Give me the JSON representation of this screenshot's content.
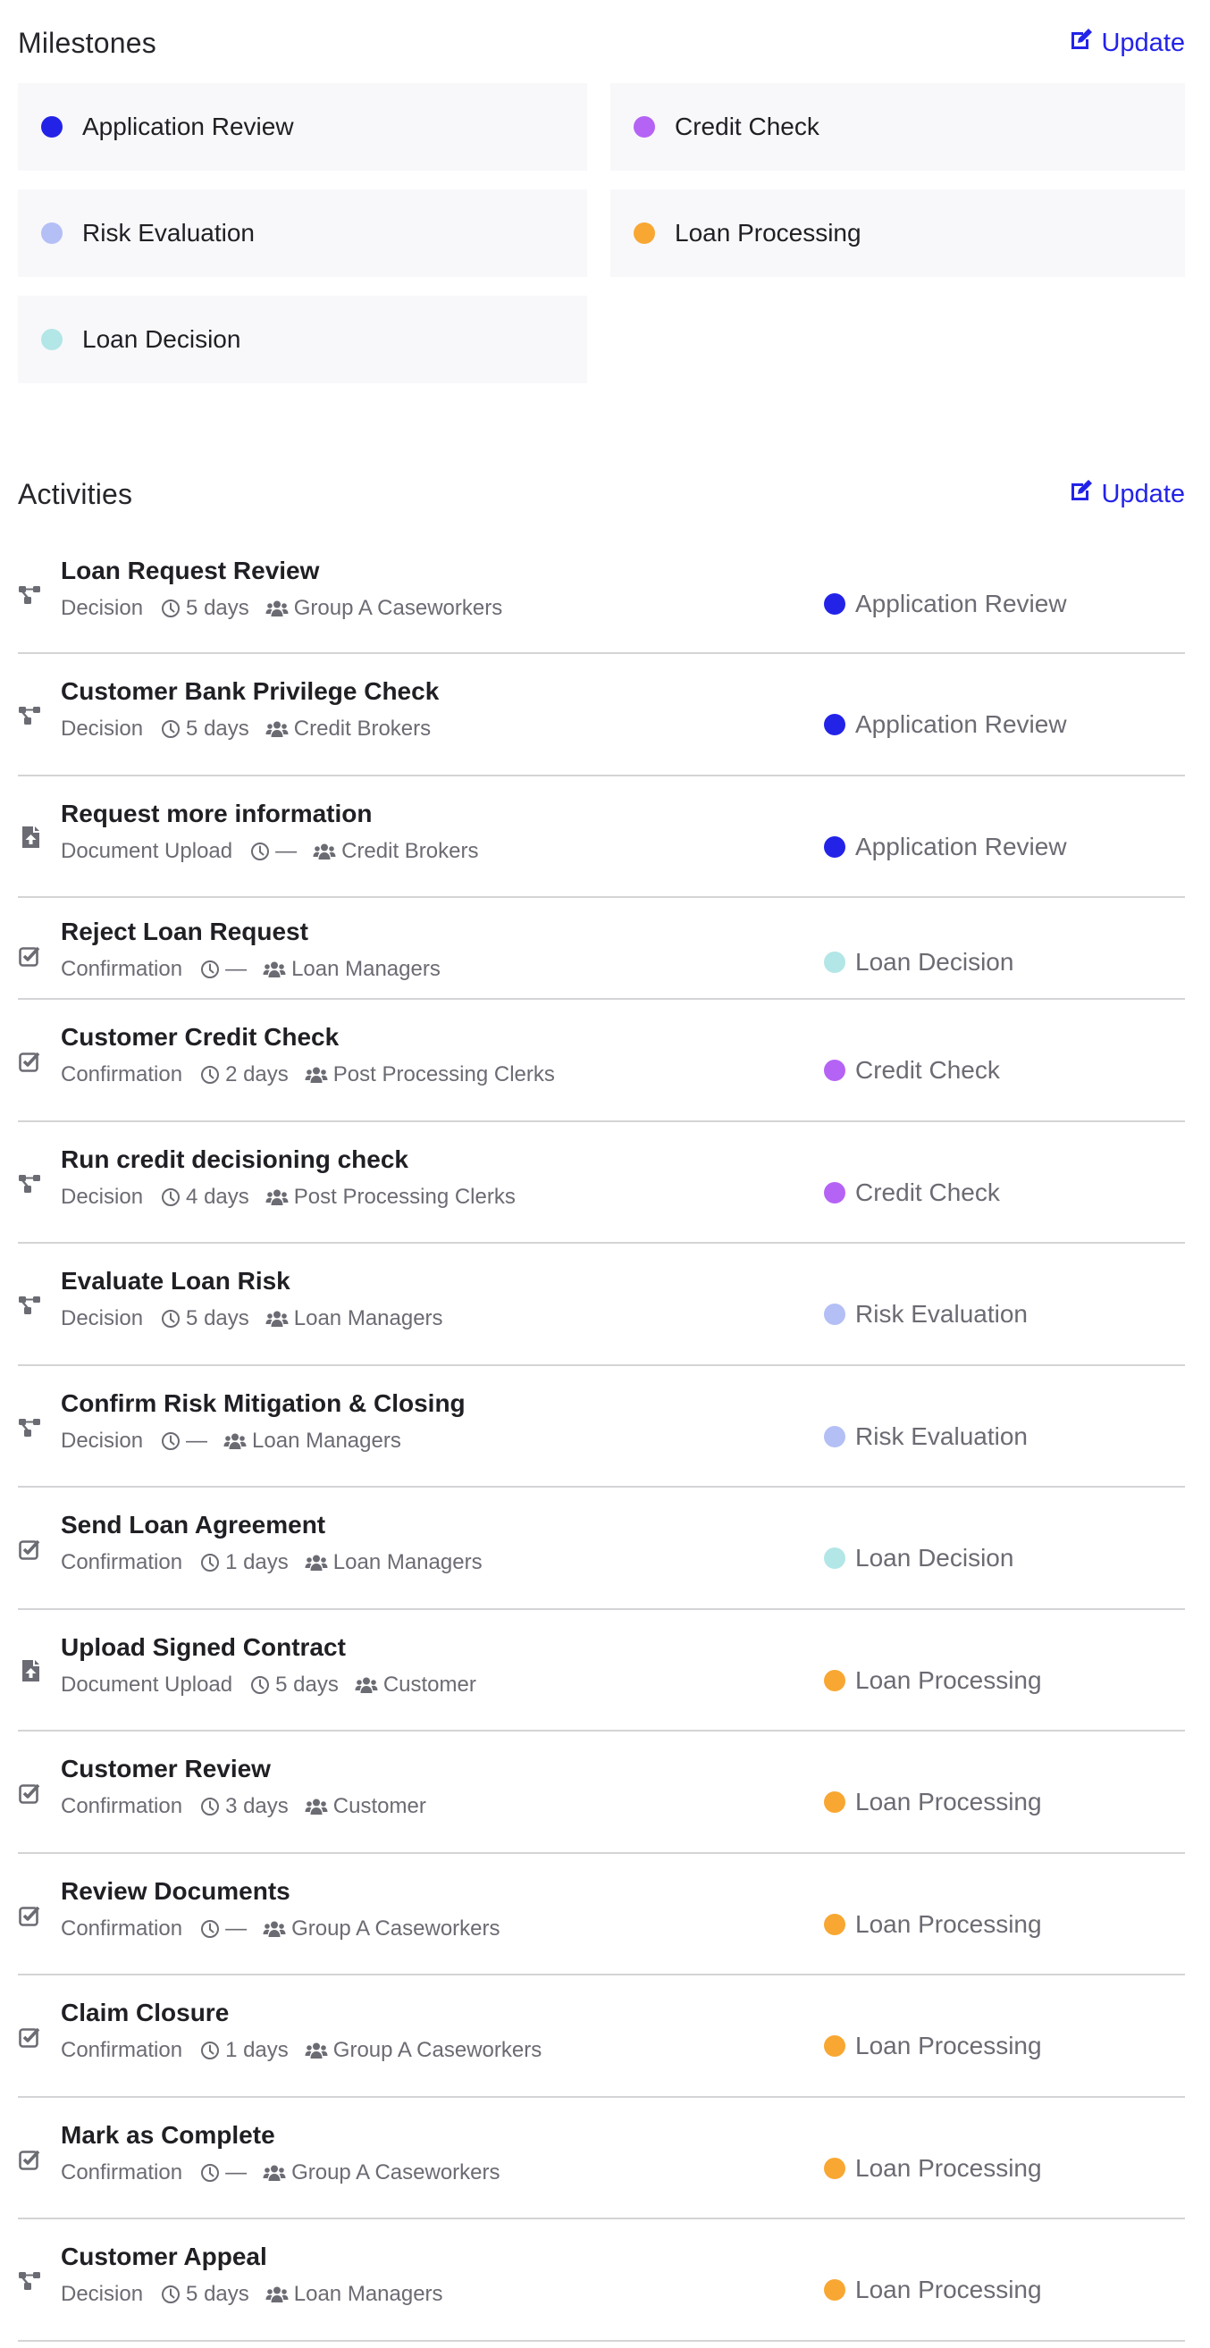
{
  "milestones": {
    "title": "Milestones",
    "update_label": "Update",
    "items": [
      {
        "label": "Application Review",
        "color": "#2323e8"
      },
      {
        "label": "Credit Check",
        "color": "#b563f5"
      },
      {
        "label": "Risk Evaluation",
        "color": "#b3bff5"
      },
      {
        "label": "Loan Processing",
        "color": "#f8a733"
      },
      {
        "label": "Loan Decision",
        "color": "#b3e6e6"
      }
    ]
  },
  "activities": {
    "title": "Activities",
    "update_label": "Update",
    "items": [
      {
        "title": "Loan Request Review",
        "type": "Decision",
        "icon": "decision-icon",
        "duration": "5 days",
        "role": "Group A Caseworkers",
        "milestone": "Application Review",
        "milestone_color": "#2323e8"
      },
      {
        "title": "Customer Bank Privilege Check",
        "type": "Decision",
        "icon": "decision-icon",
        "duration": "5 days",
        "role": "Credit Brokers",
        "milestone": "Application Review",
        "milestone_color": "#2323e8"
      },
      {
        "title": "Request more information",
        "type": "Document Upload",
        "icon": "document-upload-icon",
        "duration": "—",
        "role": "Credit Brokers",
        "milestone": "Application Review",
        "milestone_color": "#2323e8"
      },
      {
        "title": "Reject Loan Request",
        "type": "Confirmation",
        "icon": "confirmation-icon",
        "duration": "—",
        "role": "Loan Managers",
        "milestone": "Loan Decision",
        "milestone_color": "#b3e6e6"
      },
      {
        "title": "Customer Credit Check",
        "type": "Confirmation",
        "icon": "confirmation-icon",
        "duration": "2 days",
        "role": "Post Processing Clerks",
        "milestone": "Credit Check",
        "milestone_color": "#b563f5"
      },
      {
        "title": "Run credit decisioning check",
        "type": "Decision",
        "icon": "decision-icon",
        "duration": "4 days",
        "role": "Post Processing Clerks",
        "milestone": "Credit Check",
        "milestone_color": "#b563f5"
      },
      {
        "title": "Evaluate Loan Risk",
        "type": "Decision",
        "icon": "decision-icon",
        "duration": "5 days",
        "role": "Loan Managers",
        "milestone": "Risk Evaluation",
        "milestone_color": "#b3bff5"
      },
      {
        "title": "Confirm Risk Mitigation & Closing",
        "type": "Decision",
        "icon": "decision-icon",
        "duration": "—",
        "role": "Loan Managers",
        "milestone": "Risk Evaluation",
        "milestone_color": "#b3bff5"
      },
      {
        "title": "Send Loan Agreement",
        "type": "Confirmation",
        "icon": "confirmation-icon",
        "duration": "1 days",
        "role": "Loan Managers",
        "milestone": "Loan Decision",
        "milestone_color": "#b3e6e6"
      },
      {
        "title": "Upload Signed Contract",
        "type": "Document Upload",
        "icon": "document-upload-icon",
        "duration": "5 days",
        "role": "Customer",
        "milestone": "Loan Processing",
        "milestone_color": "#f8a733"
      },
      {
        "title": "Customer Review",
        "type": "Confirmation",
        "icon": "confirmation-icon",
        "duration": "3 days",
        "role": "Customer",
        "milestone": "Loan Processing",
        "milestone_color": "#f8a733"
      },
      {
        "title": "Review Documents",
        "type": "Confirmation",
        "icon": "confirmation-icon",
        "duration": "—",
        "role": "Group A Caseworkers",
        "milestone": "Loan Processing",
        "milestone_color": "#f8a733"
      },
      {
        "title": "Claim Closure",
        "type": "Confirmation",
        "icon": "confirmation-icon",
        "duration": "1 days",
        "role": "Group A Caseworkers",
        "milestone": "Loan Processing",
        "milestone_color": "#f8a733"
      },
      {
        "title": "Mark as Complete",
        "type": "Confirmation",
        "icon": "confirmation-icon",
        "duration": "—",
        "role": "Group A Caseworkers",
        "milestone": "Loan Processing",
        "milestone_color": "#f8a733"
      },
      {
        "title": "Customer Appeal",
        "type": "Decision",
        "icon": "decision-icon",
        "duration": "5 days",
        "role": "Loan Managers",
        "milestone": "Loan Processing",
        "milestone_color": "#f8a733"
      }
    ]
  }
}
